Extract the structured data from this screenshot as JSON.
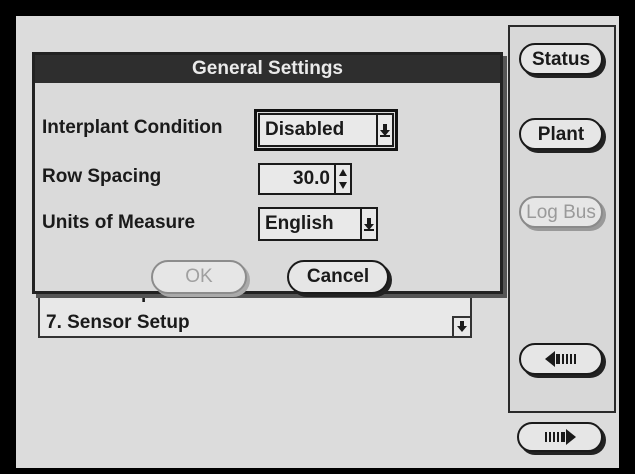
{
  "dialog": {
    "title": "General Settings",
    "rows": [
      {
        "label": "Interplant Condition",
        "value": "Disabled"
      },
      {
        "label": "Row Spacing",
        "value": "30.0"
      },
      {
        "label": "Units of Measure",
        "value": "English"
      }
    ],
    "ok_label": "OK",
    "cancel_label": "Cancel"
  },
  "side_panel": {
    "status_label": "Status",
    "plant_label": "Plant",
    "log_bus_label": "Log Bus"
  },
  "menu_list": {
    "items": [
      "6. Select Speed Sensor",
      "7. Sensor Setup"
    ]
  },
  "icons": {
    "back": "back-arrow-icon",
    "forward": "forward-arrow-icon",
    "dropdown": "dropdown-arrow-icon"
  }
}
